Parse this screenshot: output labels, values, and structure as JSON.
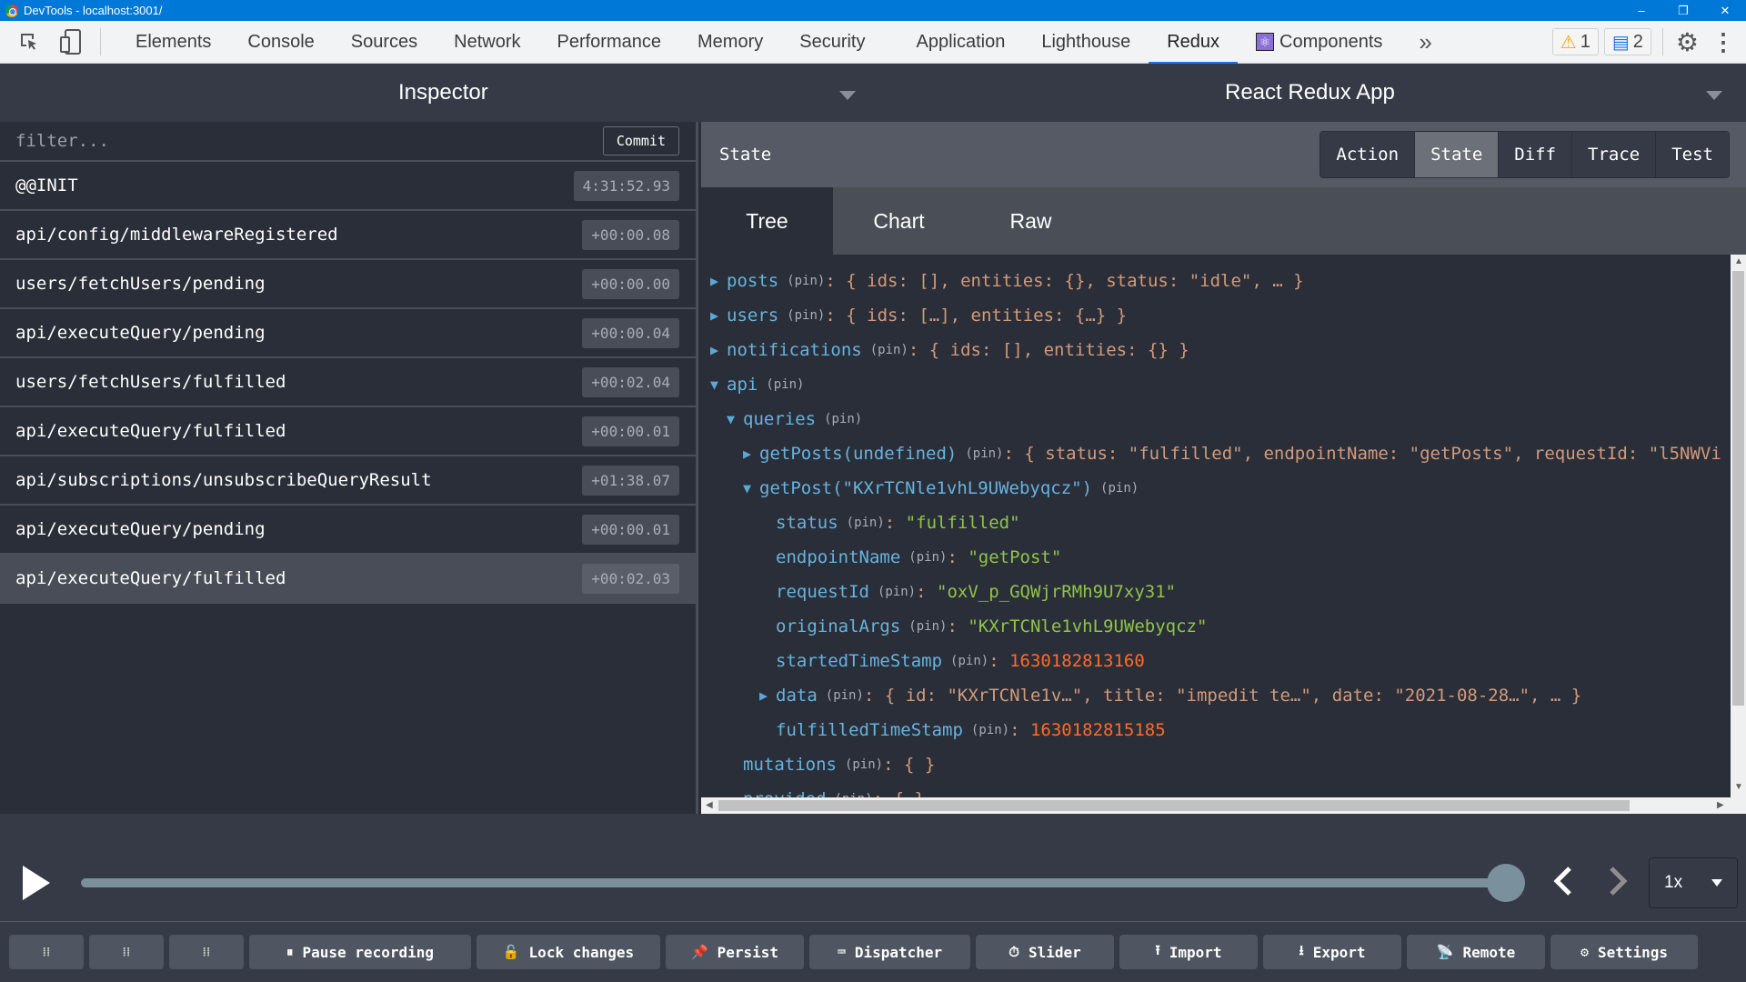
{
  "window": {
    "title": "DevTools - localhost:3001/",
    "controls": {
      "minimize": "–",
      "restore": "❐",
      "close": "✕"
    }
  },
  "devtools": {
    "tools": [
      {
        "name": "inspect-element",
        "glyph": "⬚"
      },
      {
        "name": "device-toolbar",
        "glyph": "▯"
      }
    ],
    "tabs": [
      {
        "label": "Elements",
        "active": false
      },
      {
        "label": "Console",
        "active": false
      },
      {
        "label": "Sources",
        "active": false
      },
      {
        "label": "Network",
        "active": false
      },
      {
        "label": "Performance",
        "active": false
      },
      {
        "label": "Memory",
        "active": false
      },
      {
        "label": "Security",
        "active": false
      },
      {
        "label": "Application",
        "active": false
      },
      {
        "label": "Lighthouse",
        "active": false
      },
      {
        "label": "Redux",
        "active": true
      },
      {
        "label": "Components",
        "active": false
      }
    ],
    "more_tabs": "»",
    "warnings_count": "1",
    "messages_count": "2",
    "accent": "#1a73e8",
    "titlebar_color": "#0078d7"
  },
  "inspector": {
    "title": "Inspector",
    "filter_placeholder": "filter...",
    "commit_label": "Commit",
    "actions": [
      {
        "type": "@@INIT",
        "time": "4:31:52.93",
        "selected": false
      },
      {
        "type": "api/config/middlewareRegistered",
        "time": "+00:00.08",
        "selected": false
      },
      {
        "type": "users/fetchUsers/pending",
        "time": "+00:00.00",
        "selected": false
      },
      {
        "type": "api/executeQuery/pending",
        "time": "+00:00.04",
        "selected": false
      },
      {
        "type": "users/fetchUsers/fulfilled",
        "time": "+00:02.04",
        "selected": false
      },
      {
        "type": "api/executeQuery/fulfilled",
        "time": "+00:00.01",
        "selected": false
      },
      {
        "type": "api/subscriptions/unsubscribeQueryResult",
        "time": "+01:38.07",
        "selected": false
      },
      {
        "type": "api/executeQuery/pending",
        "time": "+00:00.01",
        "selected": false
      },
      {
        "type": "api/executeQuery/fulfilled",
        "time": "+00:02.03",
        "selected": true
      }
    ]
  },
  "monitor": {
    "app_name": "React Redux App",
    "section_title": "State",
    "tabs": [
      {
        "label": "Action",
        "active": false
      },
      {
        "label": "State",
        "active": true
      },
      {
        "label": "Diff",
        "active": false
      },
      {
        "label": "Trace",
        "active": false
      },
      {
        "label": "Test",
        "active": false
      }
    ],
    "view_tabs": [
      {
        "label": "Tree",
        "active": true
      },
      {
        "label": "Chart",
        "active": false
      },
      {
        "label": "Raw",
        "active": false
      }
    ],
    "pin_label": "(pin)",
    "tree": [
      {
        "indent": 0,
        "arrow": "▶",
        "key": "posts",
        "summary": "{ ids: [], entities: {}, status: \"idle\", … }"
      },
      {
        "indent": 0,
        "arrow": "▶",
        "key": "users",
        "summary": "{ ids: […], entities: {…} }"
      },
      {
        "indent": 0,
        "arrow": "▶",
        "key": "notifications",
        "summary": "{ ids: [], entities: {} }"
      },
      {
        "indent": 0,
        "arrow": "▼",
        "key": "api",
        "summary": ""
      },
      {
        "indent": 1,
        "arrow": "▼",
        "key": "queries",
        "summary": ""
      },
      {
        "indent": 2,
        "arrow": "▶",
        "key": "getPosts(undefined)",
        "summary": "{ status: \"fulfilled\", endpointName: \"getPosts\", requestId: \"l5NWVi"
      },
      {
        "indent": 2,
        "arrow": "▼",
        "key": "getPost(\"KXrTCNle1vhL9UWebyqcz\")",
        "summary": ""
      },
      {
        "indent": 3,
        "arrow": "",
        "key": "status",
        "value": "\"fulfilled\"",
        "vtype": "str"
      },
      {
        "indent": 3,
        "arrow": "",
        "key": "endpointName",
        "value": "\"getPost\"",
        "vtype": "str"
      },
      {
        "indent": 3,
        "arrow": "",
        "key": "requestId",
        "value": "\"oxV_p_GQWjrRMh9U7xy31\"",
        "vtype": "str"
      },
      {
        "indent": 3,
        "arrow": "",
        "key": "originalArgs",
        "value": "\"KXrTCNle1vhL9UWebyqcz\"",
        "vtype": "str"
      },
      {
        "indent": 3,
        "arrow": "",
        "key": "startedTimeStamp",
        "value": "1630182813160",
        "vtype": "num"
      },
      {
        "indent": 3,
        "arrow": "▶",
        "key": "data",
        "summary": "{ id: \"KXrTCNle1v…\", title: \"impedit te…\", date: \"2021-08-28…\", … }"
      },
      {
        "indent": 3,
        "arrow": "",
        "key": "fulfilledTimeStamp",
        "value": "1630182815185",
        "vtype": "num"
      },
      {
        "indent": 1,
        "arrow": "",
        "key": "mutations",
        "summary": "{ }"
      },
      {
        "indent": 1,
        "arrow": "",
        "key": "provided",
        "summary": "{ }"
      }
    ],
    "colors": {
      "key": "#66b3e0",
      "string": "#8fc44a",
      "number": "#ff6a28",
      "punct": "#d29a7a"
    }
  },
  "slider": {
    "play": "play",
    "position_fraction": 1.0,
    "prev": "‹",
    "next": "›",
    "speed": "1x"
  },
  "toolbar": {
    "buttons": [
      {
        "name": "dock-left",
        "label": "",
        "icon": "⁞⁞"
      },
      {
        "name": "dock-right",
        "label": "",
        "icon": "⁞⁞"
      },
      {
        "name": "dock-bottom",
        "label": "",
        "icon": "⁞⁞"
      },
      {
        "name": "pause-recording",
        "label": "Pause recording",
        "icon": "⏸"
      },
      {
        "name": "lock-changes",
        "label": "Lock changes",
        "icon": "🔓"
      },
      {
        "name": "persist",
        "label": "Persist",
        "icon": "📌"
      },
      {
        "name": "dispatcher",
        "label": "Dispatcher",
        "icon": "⌨"
      },
      {
        "name": "slider",
        "label": "Slider",
        "icon": "⏱"
      },
      {
        "name": "import",
        "label": "Import",
        "icon": "⭱"
      },
      {
        "name": "export",
        "label": "Export",
        "icon": "⭳"
      },
      {
        "name": "remote",
        "label": "Remote",
        "icon": "📡"
      },
      {
        "name": "settings",
        "label": "Settings",
        "icon": "⚙"
      }
    ]
  }
}
